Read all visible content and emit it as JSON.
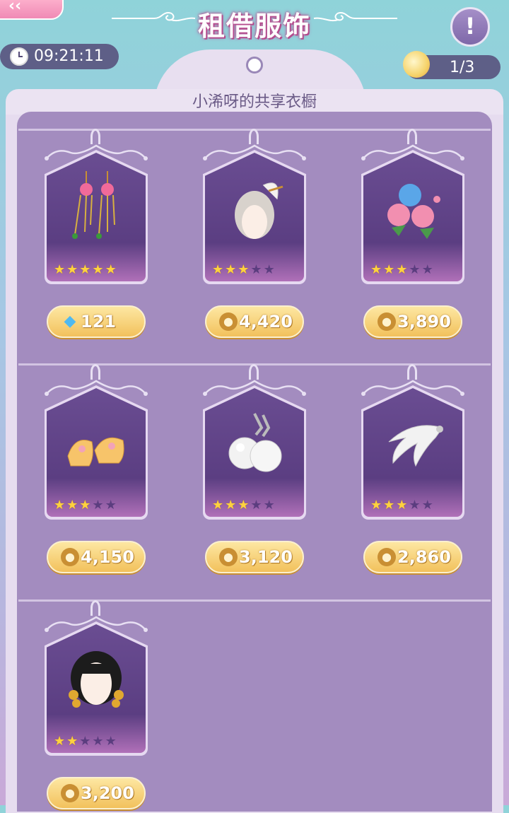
{
  "header": {
    "back_label": "‹‹",
    "title": "租借服饰",
    "info_label": "!",
    "timer": "09:21:11",
    "counter": "1/3"
  },
  "wardrobe": {
    "subtitle": "小浠呀的共享衣橱"
  },
  "items": [
    {
      "name": "earrings-pink",
      "stars": 5,
      "currency": "diamond",
      "price": "121"
    },
    {
      "name": "white-curl-hair",
      "stars": 3,
      "currency": "coin",
      "price": "4,420"
    },
    {
      "name": "rose-accessory",
      "stars": 3,
      "currency": "coin",
      "price": "3,890"
    },
    {
      "name": "golden-shoes",
      "stars": 3,
      "currency": "coin",
      "price": "4,150"
    },
    {
      "name": "pearl-earrings",
      "stars": 3,
      "currency": "coin",
      "price": "3,120"
    },
    {
      "name": "feather-accessory",
      "stars": 3,
      "currency": "coin",
      "price": "2,860"
    },
    {
      "name": "black-braided-hair",
      "stars": 2,
      "currency": "coin",
      "price": "3,200"
    }
  ],
  "colors": {
    "accent": "#c25a9b",
    "coin": "#c98f33",
    "gem": "#4fb9f0"
  }
}
